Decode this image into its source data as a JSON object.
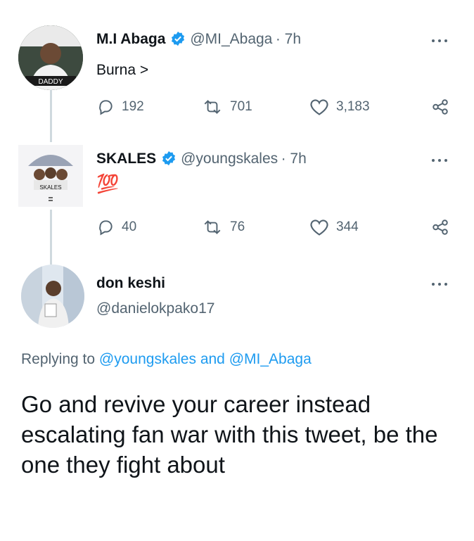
{
  "tweets": [
    {
      "name": "M.I Abaga",
      "handle": "@MI_Abaga",
      "time": "· 7h",
      "text": "Burna >",
      "replies": "192",
      "retweets": "701",
      "likes": "3,183",
      "avatar_text": "DADDY"
    },
    {
      "name": "SKALES",
      "handle": "@youngskales",
      "time": "· 7h",
      "text": "💯",
      "replies": "40",
      "retweets": "76",
      "likes": "344",
      "avatar_text": "SKALES"
    }
  ],
  "reply_tweet": {
    "name": "don keshi",
    "handle": "@danielokpako17",
    "replying_prefix": "Replying to",
    "replying_to_1": "@youngskales",
    "replying_and": "and",
    "replying_to_2": "@MI_Abaga",
    "text": "Go and revive your career instead escalating fan war with this tweet, be the one they fight about"
  },
  "colors": {
    "accent": "#1d9bf0",
    "secondary_text": "#536471",
    "thread_line": "#cfd9de"
  }
}
